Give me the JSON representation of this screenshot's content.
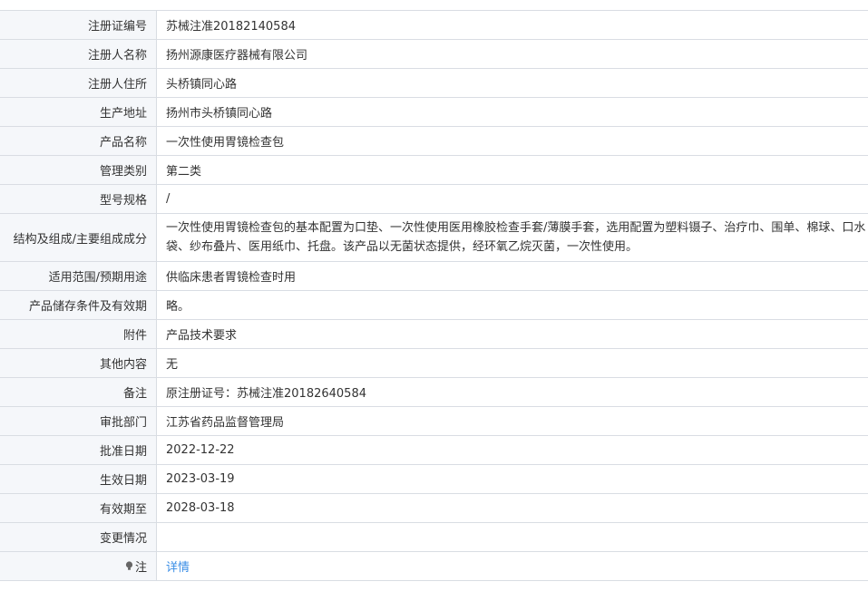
{
  "rows": [
    {
      "label": "注册证编号",
      "value": "苏械注准20182140584"
    },
    {
      "label": "注册人名称",
      "value": "扬州源康医疗器械有限公司"
    },
    {
      "label": "注册人住所",
      "value": "头桥镇同心路"
    },
    {
      "label": "生产地址",
      "value": "扬州市头桥镇同心路"
    },
    {
      "label": "产品名称",
      "value": "一次性使用胃镜检查包"
    },
    {
      "label": "管理类别",
      "value": "第二类"
    },
    {
      "label": "型号规格",
      "value": "/"
    },
    {
      "label": "结构及组成/主要组成成分",
      "value": "一次性使用胃镜检查包的基本配置为口垫、一次性使用医用橡胶检查手套/薄膜手套，选用配置为塑料镊子、治疗巾、围单、棉球、口水袋、纱布叠片、医用纸巾、托盘。该产品以无菌状态提供，经环氧乙烷灭菌，一次性使用。"
    },
    {
      "label": "适用范围/预期用途",
      "value": "供临床患者胃镜检查时用"
    },
    {
      "label": "产品储存条件及有效期",
      "value": "略。"
    },
    {
      "label": "附件",
      "value": "产品技术要求"
    },
    {
      "label": "其他内容",
      "value": "无"
    },
    {
      "label": "备注",
      "value": "原注册证号：苏械注准20182640584"
    },
    {
      "label": "审批部门",
      "value": "江苏省药品监督管理局"
    },
    {
      "label": "批准日期",
      "value": "2022-12-22"
    },
    {
      "label": "生效日期",
      "value": "2023-03-19"
    },
    {
      "label": "有效期至",
      "value": "2028-03-18"
    },
    {
      "label": "变更情况",
      "value": ""
    },
    {
      "label": "注",
      "value": "详情",
      "icon": "lightbulb-icon"
    }
  ],
  "colors": {
    "label_bg": "#f5f7fa",
    "border": "#d9dde3",
    "link": "#3a8ee6",
    "text": "#333333"
  }
}
